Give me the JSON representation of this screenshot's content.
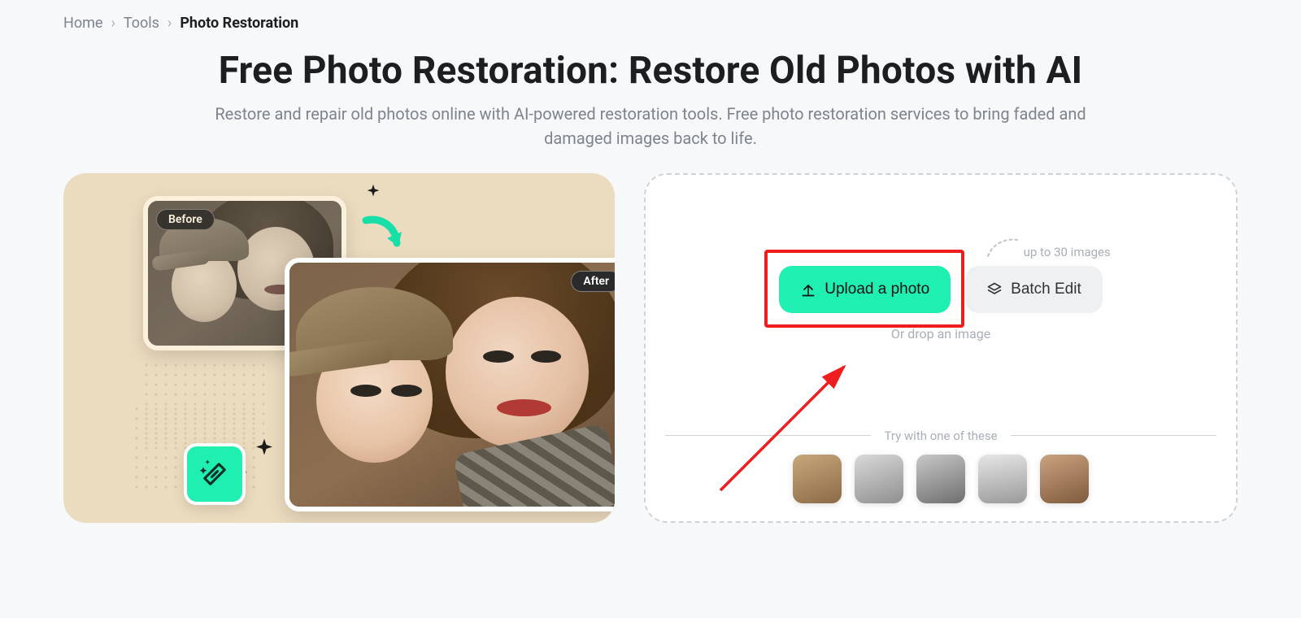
{
  "breadcrumb": {
    "items": [
      {
        "label": "Home"
      },
      {
        "label": "Tools"
      },
      {
        "label": "Photo Restoration",
        "current": true
      }
    ],
    "separator": "›"
  },
  "hero": {
    "title": "Free Photo Restoration: Restore Old Photos with AI",
    "subtitle": "Restore and repair old photos online with AI-powered restoration tools. Free photo restoration services to bring faded and damaged images back to life."
  },
  "demo": {
    "before_label": "Before",
    "after_label": "After"
  },
  "upload": {
    "primary_label": "Upload a photo",
    "secondary_label": "Batch Edit",
    "batch_hint": "up to 30 images",
    "drop_hint": "Or drop an image",
    "samples_heading": "Try with one of these",
    "sample_count": 5
  },
  "colors": {
    "accent": "#1ff0b2",
    "annotation": "#ef1d1d"
  }
}
